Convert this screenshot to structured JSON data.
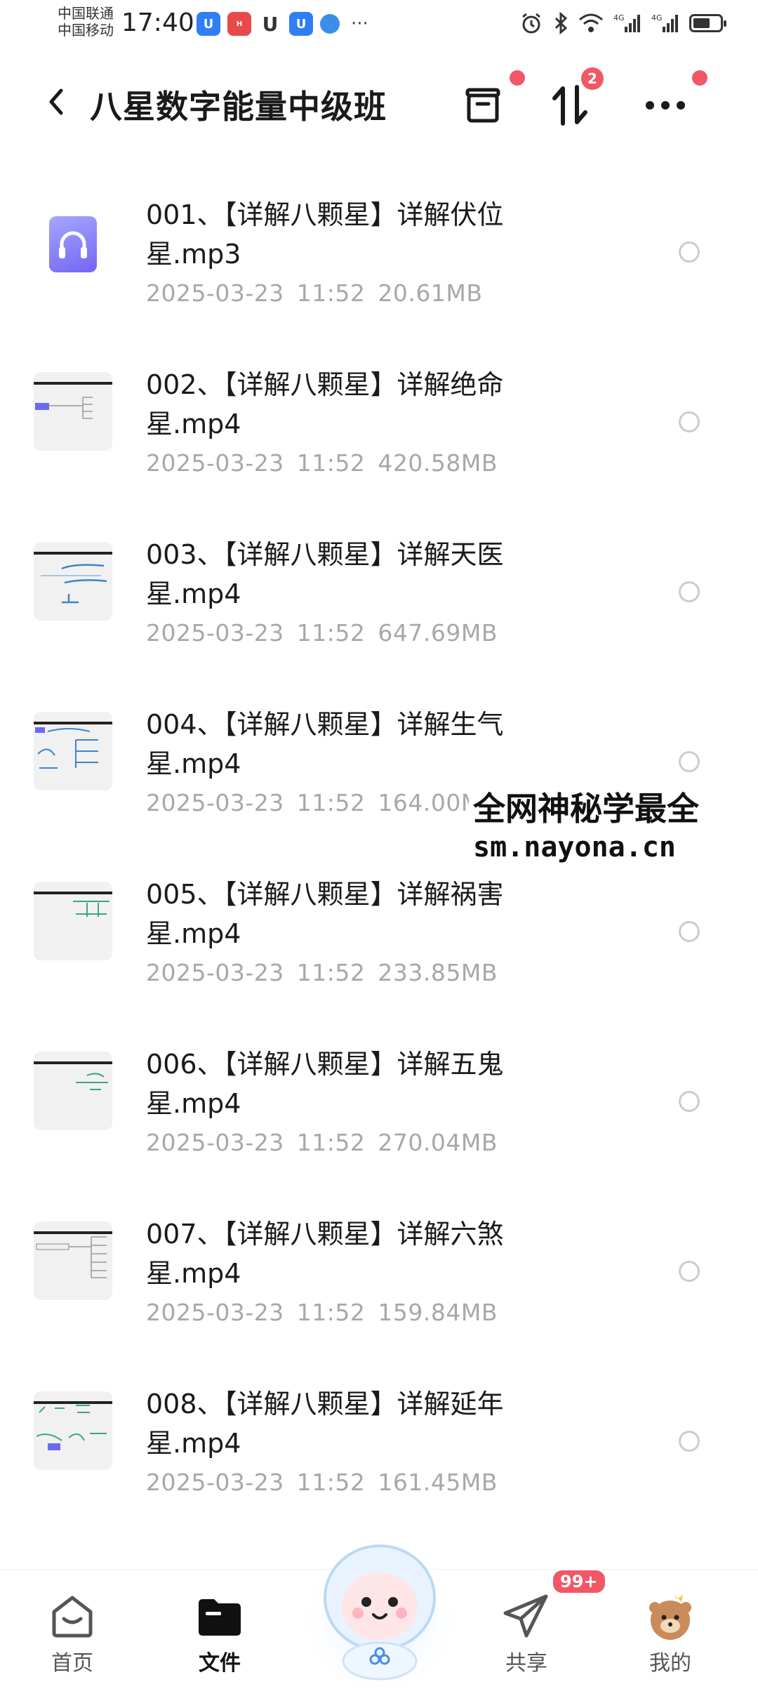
{
  "status_bar": {
    "carrier1": "中国联通",
    "carrier2": "中国移动",
    "time": "17:40",
    "more": "···"
  },
  "header": {
    "title": "八星数字能量中级班",
    "transfer_badge": "2"
  },
  "files": [
    {
      "name": "001、【详解八颗星】详解伏位星.mp3",
      "date": "2025-03-23",
      "time": "11:52",
      "size": "20.61MB",
      "thumb": "audio"
    },
    {
      "name": "002、【详解八颗星】详解绝命星.mp4",
      "date": "2025-03-23",
      "time": "11:52",
      "size": "420.58MB",
      "thumb": "video"
    },
    {
      "name": "003、【详解八颗星】详解天医星.mp4",
      "date": "2025-03-23",
      "time": "11:52",
      "size": "647.69MB",
      "thumb": "video"
    },
    {
      "name": "004、【详解八颗星】详解生气星.mp4",
      "date": "2025-03-23",
      "time": "11:52",
      "size": "164.00MB",
      "thumb": "video"
    },
    {
      "name": "005、【详解八颗星】详解祸害星.mp4",
      "date": "2025-03-23",
      "time": "11:52",
      "size": "233.85MB",
      "thumb": "video"
    },
    {
      "name": "006、【详解八颗星】详解五鬼星.mp4",
      "date": "2025-03-23",
      "time": "11:52",
      "size": "270.04MB",
      "thumb": "video"
    },
    {
      "name": "007、【详解八颗星】详解六煞星.mp4",
      "date": "2025-03-23",
      "time": "11:52",
      "size": "159.84MB",
      "thumb": "video"
    },
    {
      "name": "008、【详解八颗星】详解延年星.mp4",
      "date": "2025-03-23",
      "time": "11:52",
      "size": "161.45MB",
      "thumb": "video"
    }
  ],
  "watermark": {
    "line1": "全网神秘学最全",
    "line2": "sm.nayona.cn"
  },
  "nav": {
    "home": "首页",
    "files": "文件",
    "share": "共享",
    "share_badge": "99+",
    "mine": "我的"
  },
  "colors": {
    "accent_red": "#f25767",
    "audio_icon": "#7466f0",
    "meta_gray": "#a8a8a8"
  }
}
